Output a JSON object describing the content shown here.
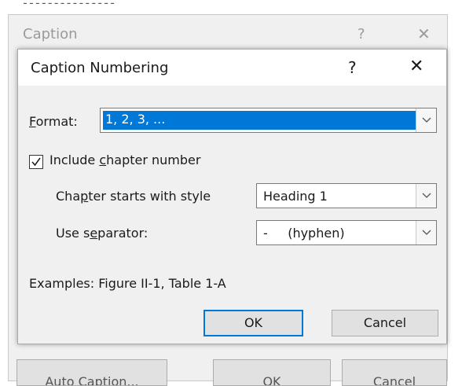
{
  "background_dialog": {
    "title": "Caption",
    "help": "?",
    "close": "✕",
    "buttons": [
      "Auto Caption...",
      "OK",
      "Cancel"
    ]
  },
  "dialog": {
    "title": "Caption Numbering",
    "help_label": "?",
    "close_label": "✕",
    "format": {
      "label_prefix": "",
      "label_accel": "F",
      "label_rest": "ormat:",
      "value": "1, 2, 3, ..."
    },
    "include_chapter": {
      "checked": true,
      "label_pre": "Include ",
      "label_accel": "c",
      "label_post": "hapter number"
    },
    "chapter_style": {
      "label_pre": "Cha",
      "label_accel": "p",
      "label_post": "ter starts with style",
      "value": "Heading 1"
    },
    "separator": {
      "label_pre": "Use s",
      "label_accel": "e",
      "label_post": "parator:",
      "value": "-     (hyphen)"
    },
    "examples": "Examples:   Figure II-1, Table 1-A",
    "ok_label": "OK",
    "cancel_label": "Cancel"
  },
  "icons": {
    "dropdown": "chevron-down-icon",
    "checkbox": "checkmark-icon",
    "close": "close-icon"
  },
  "colors": {
    "selection": "#0078d7",
    "dialog_bg": "#f0f0f0",
    "default_button_border": "#0078d7"
  }
}
